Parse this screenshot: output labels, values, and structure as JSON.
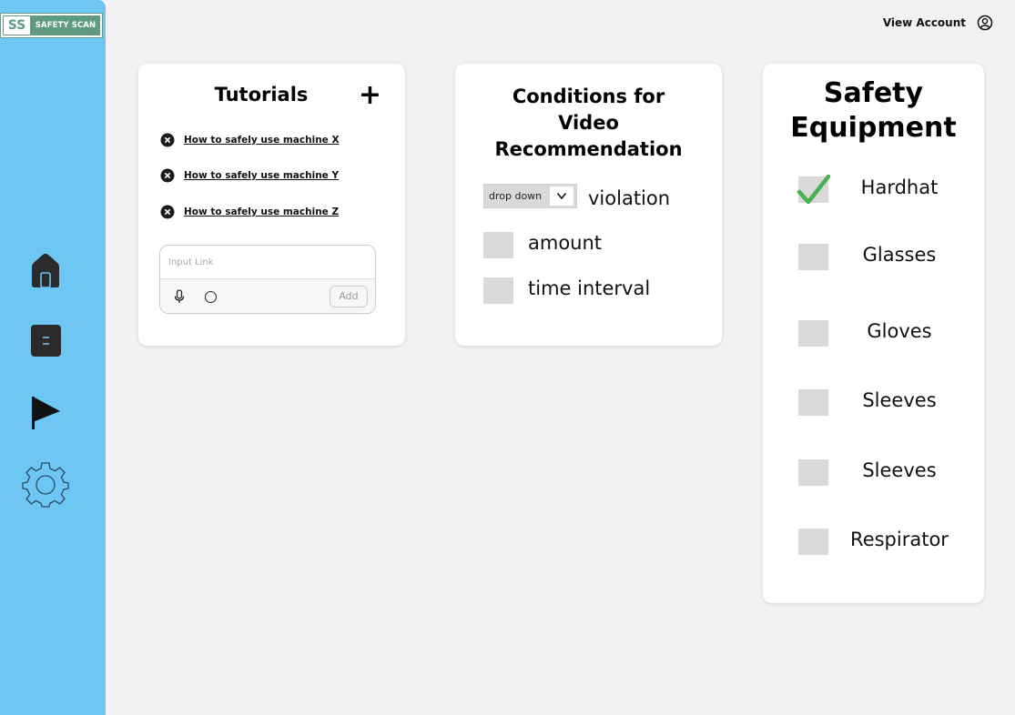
{
  "app": {
    "logo_mark": "SS",
    "logo_name": "SAFETY SCAN"
  },
  "sidebar": {
    "items": [
      {
        "icon": "home-icon"
      },
      {
        "icon": "document-icon"
      },
      {
        "icon": "flag-icon"
      },
      {
        "icon": "gear-icon"
      }
    ]
  },
  "header": {
    "account_label": "View Account",
    "account_icon": "user-circle-icon"
  },
  "tutorials": {
    "title": "Tutorials",
    "add_icon": "+",
    "items": [
      {
        "label": "How to safely use machine X"
      },
      {
        "label": "How to safely use machine Y"
      },
      {
        "label": "How to safely use machine Z"
      }
    ],
    "input": {
      "placeholder": "Input Link",
      "value": "",
      "add_label": "Add"
    }
  },
  "conditions": {
    "title_line1": "Conditions for",
    "title_line2": "Video",
    "title_line3": "Recommendation",
    "dropdown": {
      "selected": "drop down"
    },
    "items": [
      {
        "label": "violation"
      },
      {
        "label": "amount",
        "checked": false
      },
      {
        "label": "time interval",
        "checked": false
      }
    ]
  },
  "equipment": {
    "title_line1": "Safety",
    "title_line2": "Equipment",
    "items": [
      {
        "label": "Hardhat",
        "checked": true
      },
      {
        "label": "Glasses",
        "checked": false
      },
      {
        "label": "Gloves",
        "checked": false
      },
      {
        "label": "Sleeves",
        "checked": false
      },
      {
        "label": "Sleeves",
        "checked": false
      },
      {
        "label": "Respirator",
        "checked": false
      }
    ]
  },
  "colors": {
    "sidebar": "#6ec6f4",
    "background": "#f2f2f2",
    "logo_green": "#5f9b80",
    "checkbox": "#d9d9d9",
    "checkmark": "#4caf50"
  }
}
